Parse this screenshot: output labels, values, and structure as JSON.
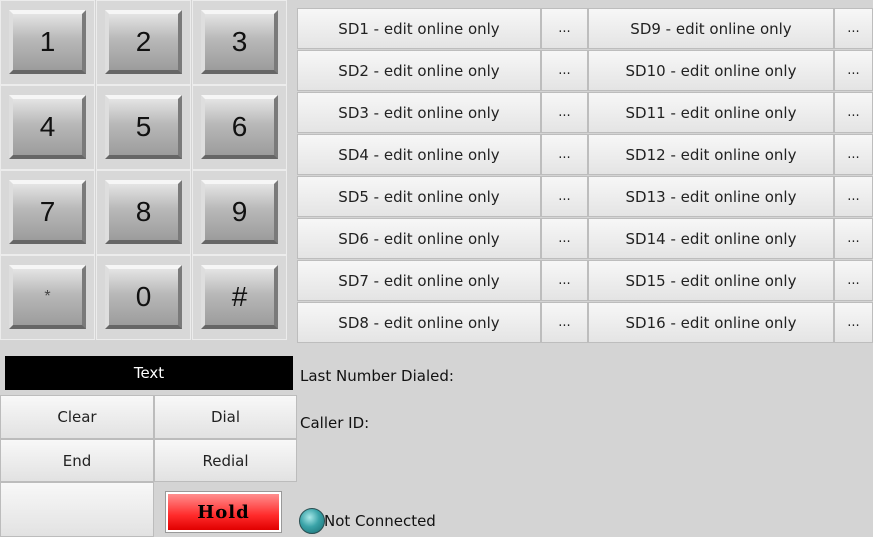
{
  "keypad": {
    "keys": [
      "1",
      "2",
      "3",
      "4",
      "5",
      "6",
      "7",
      "8",
      "9",
      "*",
      "0",
      "#"
    ]
  },
  "speed_dials": [
    "SD1 - edit online only",
    "SD2 - edit online only",
    "SD3 - edit online only",
    "SD4 - edit online only",
    "SD5 - edit online only",
    "SD6 - edit online only",
    "SD7 - edit online only",
    "SD8 - edit online only",
    "SD9 - edit online only",
    "SD10 - edit online only",
    "SD11 - edit online only",
    "SD12 - edit online only",
    "SD13 - edit online only",
    "SD14 - edit online only",
    "SD15 - edit online only",
    "SD16 - edit online only"
  ],
  "speed_dial_more_label": "...",
  "text_display": "Text",
  "buttons": {
    "clear": "Clear",
    "dial": "Dial",
    "end": "End",
    "redial": "Redial",
    "hold": "Hold"
  },
  "info": {
    "last_number_label": "Last Number Dialed:",
    "caller_id_label": "Caller ID:",
    "status": "Not Connected"
  },
  "colors": {
    "hold_button": "#ff2a2a",
    "status_indicator": "#3aa3a8",
    "text_display_bg": "#000000"
  },
  "icons": {
    "status": "status-indicator-icon"
  }
}
